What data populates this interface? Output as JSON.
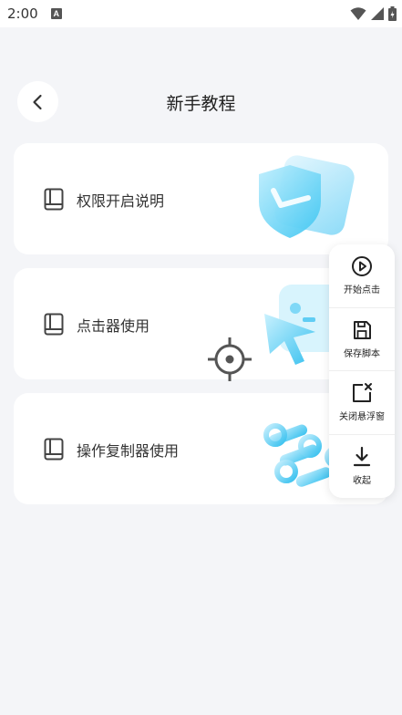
{
  "status_bar": {
    "time": "2:00",
    "notification_icon_letter": "A",
    "icons": [
      "wifi-icon",
      "signal-icon",
      "battery-icon"
    ]
  },
  "header": {
    "title": "新手教程",
    "back_icon": "chevron-left-icon"
  },
  "cards": [
    {
      "label": "权限开启说明",
      "icon": "book-icon",
      "art": "shield-illustration"
    },
    {
      "label": "点击器使用",
      "icon": "book-icon",
      "art": "cursor-illustration"
    },
    {
      "label": "操作复制器使用",
      "icon": "book-icon",
      "art": "chain-illustration"
    }
  ],
  "floating_panel": {
    "items": [
      {
        "label": "开始点击",
        "icon": "play-circle-icon"
      },
      {
        "label": "保存脚本",
        "icon": "save-icon"
      },
      {
        "label": "关闭悬浮窗",
        "icon": "close-window-icon"
      },
      {
        "label": "收起",
        "icon": "download-icon"
      }
    ]
  },
  "colors": {
    "background": "#f4f5f8",
    "card": "#ffffff",
    "illustration_blue": "#4fc3f7"
  }
}
